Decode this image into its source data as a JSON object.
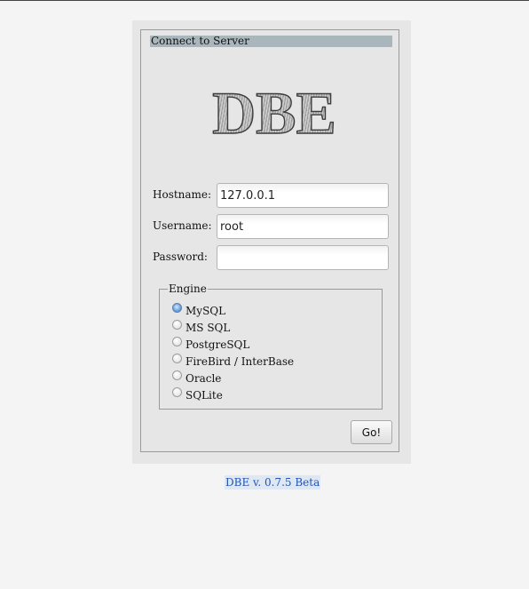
{
  "dialog": {
    "title": "Connect to Server",
    "logo_text": "DBE"
  },
  "form": {
    "hostname": {
      "label": "Hostname:",
      "value": "127.0.0.1"
    },
    "username": {
      "label": "Username:",
      "value": "root"
    },
    "password": {
      "label": "Password:",
      "value": ""
    }
  },
  "engine": {
    "legend": "Engine",
    "selected": "MySQL",
    "options": [
      "MySQL",
      "MS SQL",
      "PostgreSQL",
      "FireBird / InterBase",
      "Oracle",
      "SQLite"
    ]
  },
  "actions": {
    "go_label": "Go!"
  },
  "footer": {
    "version_text": "DBE v. 0.7.5 Beta"
  },
  "colors": {
    "page_background": "#f4f4f4",
    "panel_background": "#e6e6e6",
    "title_bar": "#a9b6bc",
    "link": "#2155b5",
    "radio_checked": "#3f77b8"
  }
}
